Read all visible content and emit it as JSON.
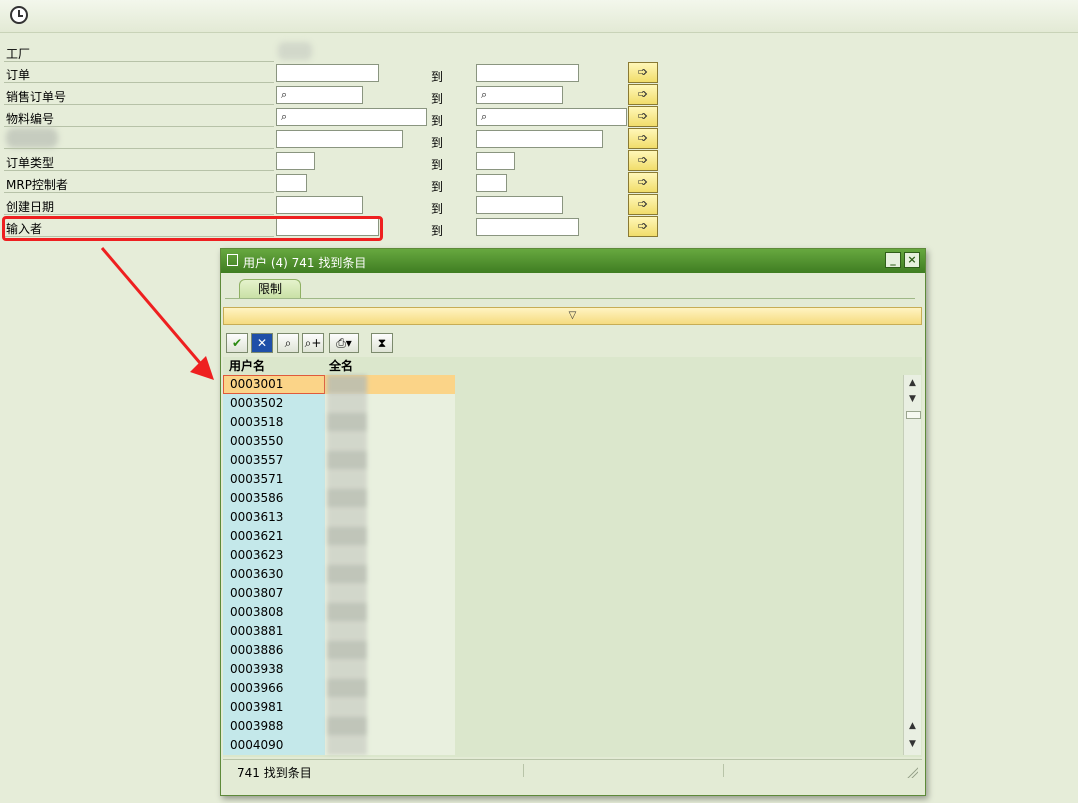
{
  "toolbar": {
    "execute_icon": "clock-execute-icon"
  },
  "form": {
    "to_label": "到",
    "fields": [
      {
        "label": "工厂",
        "search": false
      },
      {
        "label": "订单",
        "search": false
      },
      {
        "label": "销售订单号",
        "search": true
      },
      {
        "label": "物料编号",
        "search": true
      },
      {
        "label": "",
        "search": false
      },
      {
        "label": "订单类型",
        "search": false
      },
      {
        "label": "MRP控制者",
        "search": false
      },
      {
        "label": "创建日期",
        "search": false
      },
      {
        "label": "输入者",
        "search": false
      }
    ],
    "multi_select_icon": "multiple-selection-arrow-icon"
  },
  "popup": {
    "title": "用户 (4)  741 找到条目",
    "tab_label": "限制",
    "collapse_icon": "triangle-down-icon",
    "toolbar_icons": [
      "checkmark-icon",
      "cancel-icon",
      "find-icon",
      "find-next-icon",
      "print-icon",
      "sort-icon"
    ],
    "columns": [
      "用户名",
      "全名"
    ],
    "rows": [
      "0003001",
      "0003502",
      "0003518",
      "0003550",
      "0003557",
      "0003571",
      "0003586",
      "0003613",
      "0003621",
      "0003623",
      "0003630",
      "0003807",
      "0003808",
      "0003881",
      "0003886",
      "0003938",
      "0003966",
      "0003981",
      "0003988",
      "0004090"
    ],
    "status": "741 找到条目"
  },
  "colors": {
    "highlight": "#ee2020",
    "title_bar": "#4b8c2c",
    "selected_row": "#fbd488",
    "key_column": "#c4e8ea"
  }
}
